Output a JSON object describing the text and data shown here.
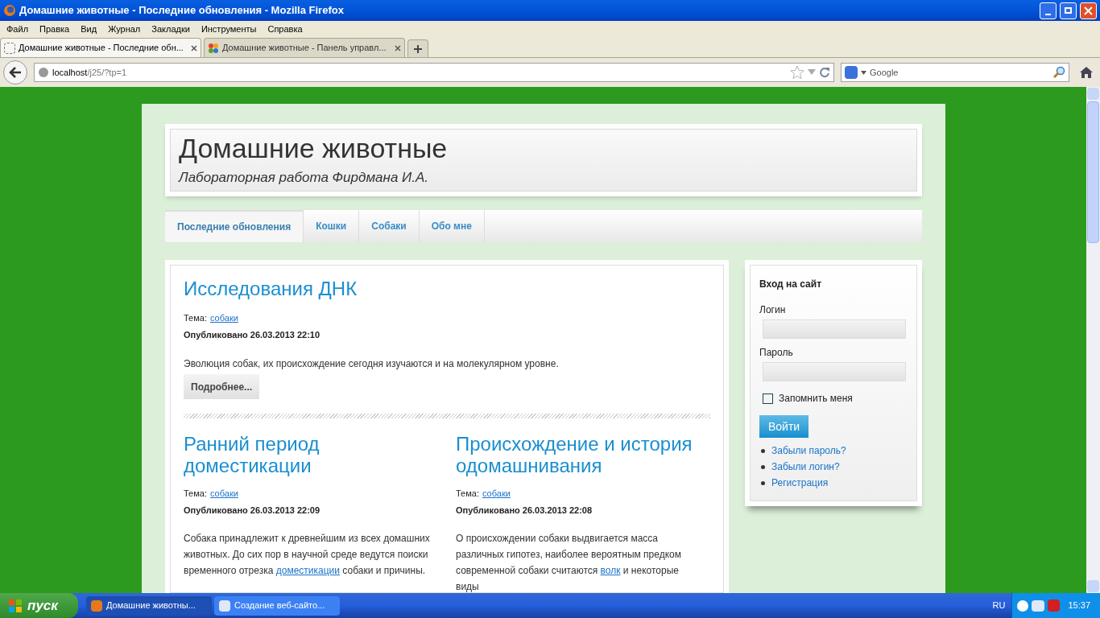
{
  "window": {
    "title": "Домашние животные - Последние обновления - Mozilla Firefox"
  },
  "menu": [
    "Файл",
    "Правка",
    "Вид",
    "Журнал",
    "Закладки",
    "Инструменты",
    "Справка"
  ],
  "tabs": [
    {
      "label": "Домашние животные - Последние обн...",
      "selected": true
    },
    {
      "label": "Домашние животные - Панель управл...",
      "selected": false
    }
  ],
  "address": {
    "host": "localhost",
    "path": "/j25/?tp=1"
  },
  "search": {
    "placeholder": "Google"
  },
  "site": {
    "title": "Домашние животные",
    "subtitle": "Лабораторная работа Фирдмана И.А."
  },
  "nav": [
    {
      "label": "Последние обновления",
      "selected": true
    },
    {
      "label": "Кошки",
      "selected": false
    },
    {
      "label": "Собаки",
      "selected": false
    },
    {
      "label": "Обо мне",
      "selected": false
    }
  ],
  "lead": {
    "title": "Исследования ДНК",
    "topic_label": "Тема:",
    "topic": "собаки",
    "published": "Опубликовано 26.03.2013 22:10",
    "text": [
      {
        "text": "Эволюция собак, их происхождение сегодня изучаются и на молекулярном уровне."
      }
    ],
    "more": "Подробнее..."
  },
  "articles": [
    {
      "title": "Ранний период доместикации",
      "topic_label": "Тема:",
      "topic": "собаки",
      "published": "Опубликовано 26.03.2013 22:09",
      "text": [
        {
          "text": "Собака принадлежит к древнейшим из всех домашних животных. До сих пор в научной среде ведутся поиски временного отрезка "
        },
        {
          "link": "доместикации"
        },
        {
          "text": " собаки и причины."
        }
      ]
    },
    {
      "title": "Происхождение и история одомашнивания",
      "topic_label": "Тема:",
      "topic": "собаки",
      "published": "Опубликовано 26.03.2013 22:08",
      "text": [
        {
          "text": "О происхождении собаки выдвигается масса различных гипотез, наиболее вероятным предком современной собаки считаются "
        },
        {
          "link": "волк"
        },
        {
          "text": " и некоторые виды"
        }
      ]
    }
  ],
  "login": {
    "title": "Вход на сайт",
    "username_label": "Логин",
    "password_label": "Пароль",
    "remember": {
      "label": "Запомнить меня",
      "checked": false
    },
    "submit": "Войти",
    "links": [
      "Забыли пароль?",
      "Забыли логин?",
      "Регистрация"
    ]
  },
  "taskbar": {
    "start": "пуск",
    "tasks": [
      {
        "label": "Домашние животны...",
        "selected": true
      },
      {
        "label": "Создание веб-сайто...",
        "selected": false
      }
    ],
    "language": "RU",
    "clock": "15:37"
  }
}
